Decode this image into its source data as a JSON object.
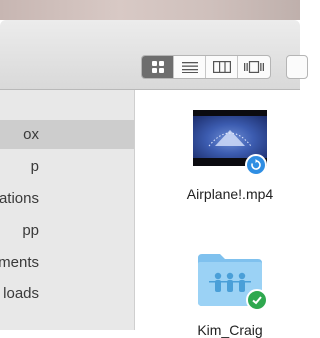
{
  "window": {
    "view_modes": [
      {
        "name": "icon",
        "active": true
      },
      {
        "name": "list",
        "active": false
      },
      {
        "name": "column",
        "active": false
      },
      {
        "name": "cover-flow",
        "active": false
      }
    ]
  },
  "sidebar": {
    "items": [
      {
        "label": "ox",
        "selected": true
      },
      {
        "label": "p",
        "selected": false
      },
      {
        "label": "ations",
        "selected": false
      },
      {
        "label": "pp",
        "selected": false
      },
      {
        "label": "ments",
        "selected": false
      },
      {
        "label": "loads",
        "selected": false
      }
    ]
  },
  "files": [
    {
      "name": "Airplane!.mp4",
      "kind": "video",
      "badge": "sync-icon"
    },
    {
      "name": "Kim_Craig",
      "kind": "folder",
      "badge": "checkmark-icon"
    }
  ],
  "colors": {
    "sync_badge": "#2f8ee3",
    "done_badge": "#2fa84f",
    "folder_blue": "#8ccaf1",
    "sidebar_selected": "#cdcdcd"
  }
}
